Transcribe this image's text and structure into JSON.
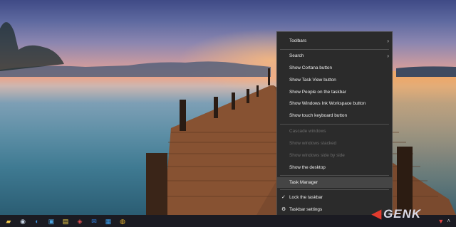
{
  "context_menu": {
    "items": [
      {
        "label": "Toolbars",
        "submenu": true,
        "enabled": true
      },
      {
        "label": "Search",
        "submenu": true,
        "enabled": true
      },
      {
        "label": "Show Cortana button",
        "enabled": true
      },
      {
        "label": "Show Task View button",
        "enabled": true
      },
      {
        "label": "Show People on the taskbar",
        "enabled": true
      },
      {
        "label": "Show Windows Ink Workspace button",
        "enabled": true
      },
      {
        "label": "Show touch keyboard button",
        "enabled": true
      },
      {
        "label": "Cascade windows",
        "enabled": false
      },
      {
        "label": "Show windows stacked",
        "enabled": false
      },
      {
        "label": "Show windows side by side",
        "enabled": false
      },
      {
        "label": "Show the desktop",
        "enabled": true
      },
      {
        "label": "Task Manager",
        "enabled": true,
        "highlighted": true
      },
      {
        "label": "Lock the taskbar",
        "enabled": true,
        "checked": true
      },
      {
        "label": "Taskbar settings",
        "enabled": true,
        "icon": "gear-icon"
      }
    ]
  },
  "taskbar": {
    "icons": [
      "folder-icon",
      "steam-icon",
      "edge-icon",
      "store-icon",
      "notes-icon",
      "paint-icon",
      "mail-icon",
      "windows-icon",
      "chrome-icon"
    ],
    "tray_icons": [
      "shield-icon",
      "chevron-up-icon"
    ]
  },
  "watermark": {
    "text": "GENK"
  },
  "colors": {
    "menu_bg": "#2b2b2b",
    "menu_text": "#f0f0f0",
    "disabled_text": "#6c6c6c",
    "highlight": "#454545",
    "taskbar_bg": "#1b1b22"
  }
}
